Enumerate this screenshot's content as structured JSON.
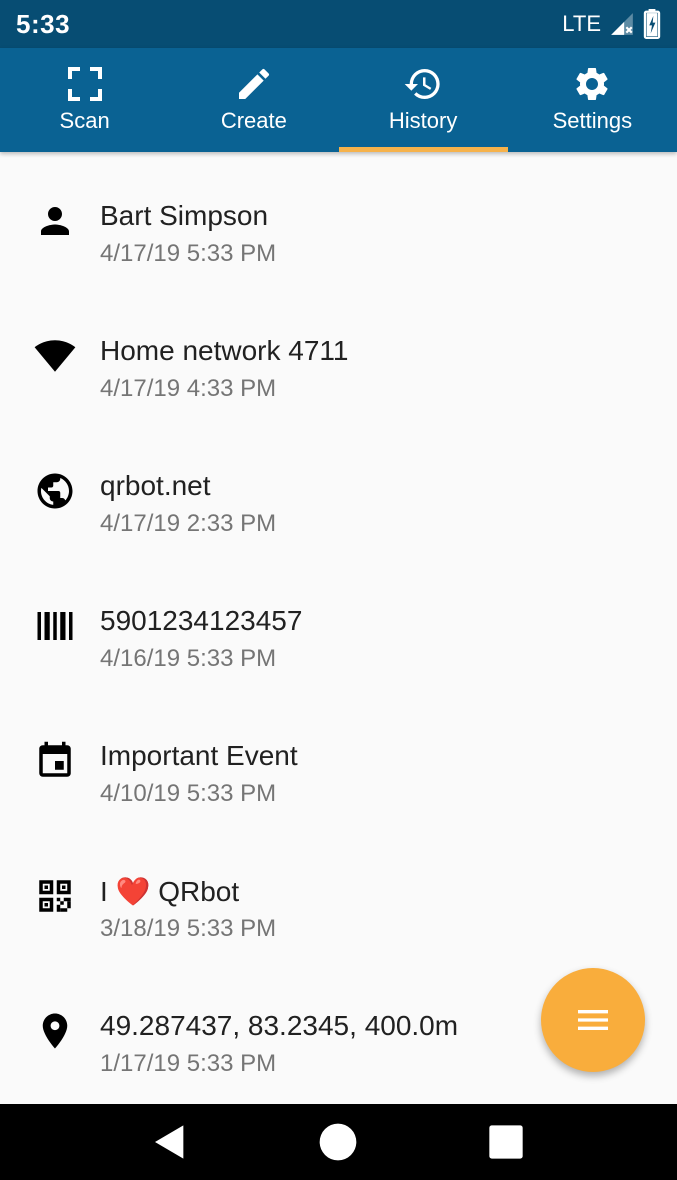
{
  "status_bar": {
    "time": "5:33",
    "network": "LTE",
    "icons": [
      "signal-icon",
      "battery-icon"
    ]
  },
  "colors": {
    "status_bar": "#074d73",
    "app_bar": "#0a6293",
    "tab_indicator": "#f6b24b",
    "fab": "#f9ad3c",
    "background": "#fafafa"
  },
  "tabs": [
    {
      "label": "Scan",
      "icon": "scan-frame-icon"
    },
    {
      "label": "Create",
      "icon": "pencil-icon"
    },
    {
      "label": "History",
      "icon": "history-icon",
      "selected": true
    },
    {
      "label": "Settings",
      "icon": "gear-icon"
    }
  ],
  "history": [
    {
      "title": "Bart Simpson",
      "date": "4/17/19 5:33 PM",
      "icon": "person-icon"
    },
    {
      "title": "Home network 4711",
      "date": "4/17/19 4:33 PM",
      "icon": "wifi-icon"
    },
    {
      "title": "qrbot.net",
      "date": "4/17/19 2:33 PM",
      "icon": "globe-icon"
    },
    {
      "title": "5901234123457",
      "date": "4/16/19 5:33 PM",
      "icon": "barcode-icon"
    },
    {
      "title": "Important Event",
      "date": "4/10/19 5:33 PM",
      "icon": "calendar-icon"
    },
    {
      "title_prefix": "I",
      "title_emoji": "❤️",
      "title_suffix": "QRbot",
      "date": "3/18/19 5:33 PM",
      "icon": "qr-code-icon"
    },
    {
      "title": "49.287437, 83.2345, 400.0m",
      "date": "1/17/19 5:33 PM",
      "icon": "location-pin-icon"
    }
  ],
  "fab": {
    "icon": "menu-icon"
  },
  "nav_bar": {
    "icons": [
      "back-icon",
      "home-icon",
      "recents-icon"
    ]
  }
}
